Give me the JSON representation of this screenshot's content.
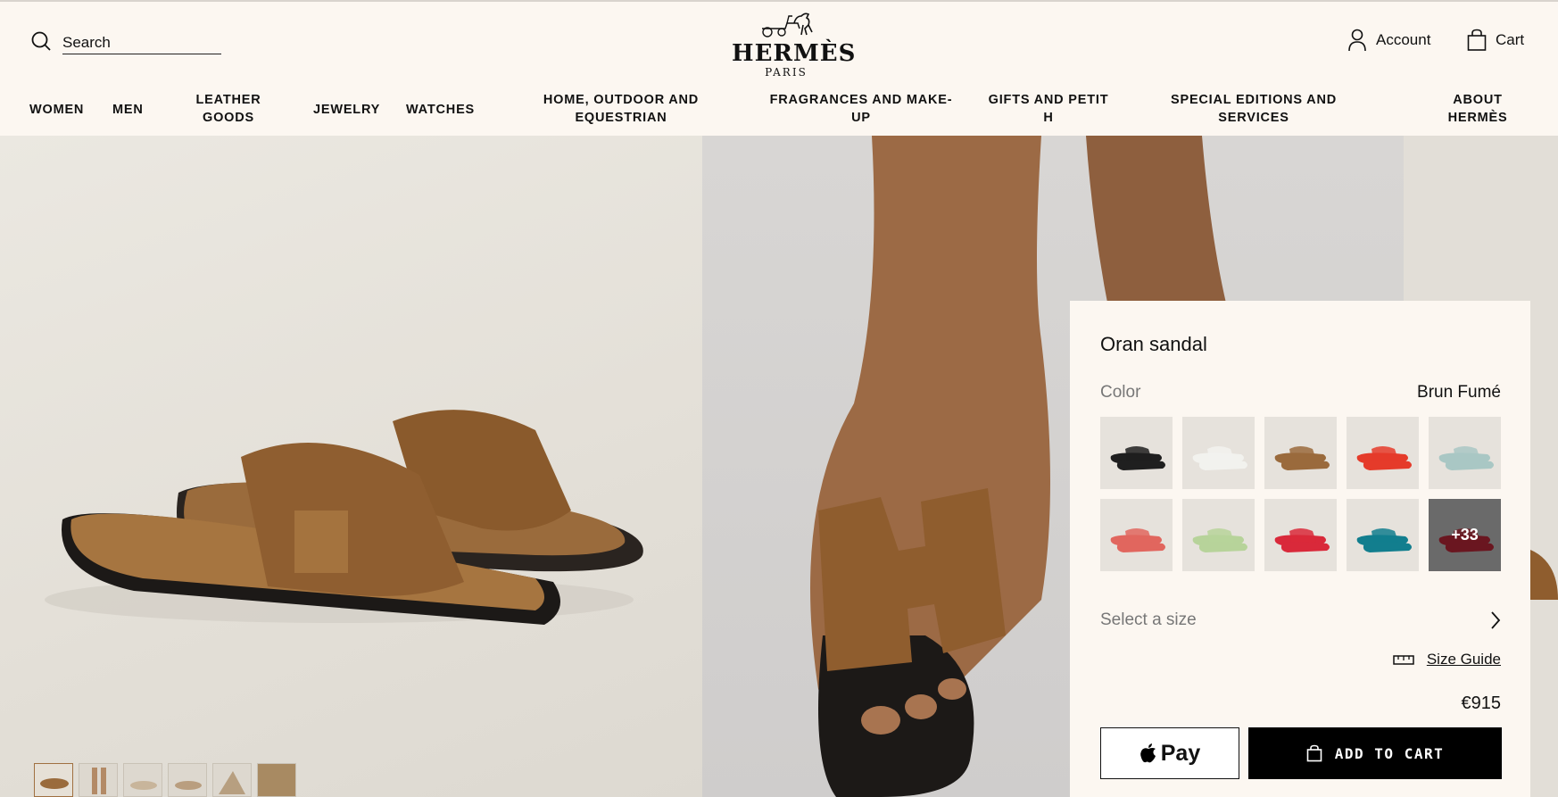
{
  "header": {
    "search_placeholder": "Search",
    "logo_word": "HERMÈS",
    "logo_sub": "PARIS",
    "account_label": "Account",
    "cart_label": "Cart"
  },
  "nav": {
    "women": "WOMEN",
    "men": "MEN",
    "leather_1": "LEATHER",
    "leather_2": "GOODS",
    "jewelry": "JEWELRY",
    "watches": "WATCHES",
    "home_1": "HOME, OUTDOOR AND",
    "home_2": "EQUESTRIAN",
    "frag_1": "FRAGRANCES AND MAKE-",
    "frag_2": "UP",
    "gifts_1": "GIFTS AND PETIT",
    "gifts_2": "H",
    "special_1": "SPECIAL EDITIONS AND",
    "special_2": "SERVICES",
    "about_1": "ABOUT",
    "about_2": "HERMÈS"
  },
  "product": {
    "title": "Oran sandal",
    "color_label": "Color",
    "color_value": "Brun Fumé",
    "swatch_colors": [
      "#1f1f1f",
      "#f2f2ee",
      "#9a6a3c",
      "#e53b2a",
      "#a9c7c4",
      "#e1665e",
      "#b7d39a",
      "#d9293a",
      "#127e8e",
      "#6a1620"
    ],
    "more_colors": "+33",
    "size_placeholder": "Select a size",
    "size_guide": "Size Guide",
    "price": "€915",
    "apple_pay": "Pay",
    "add_to_cart": "ADD TO CART"
  },
  "gallery": {
    "thumbnail_count": 6,
    "active_thumbnail": 1
  }
}
